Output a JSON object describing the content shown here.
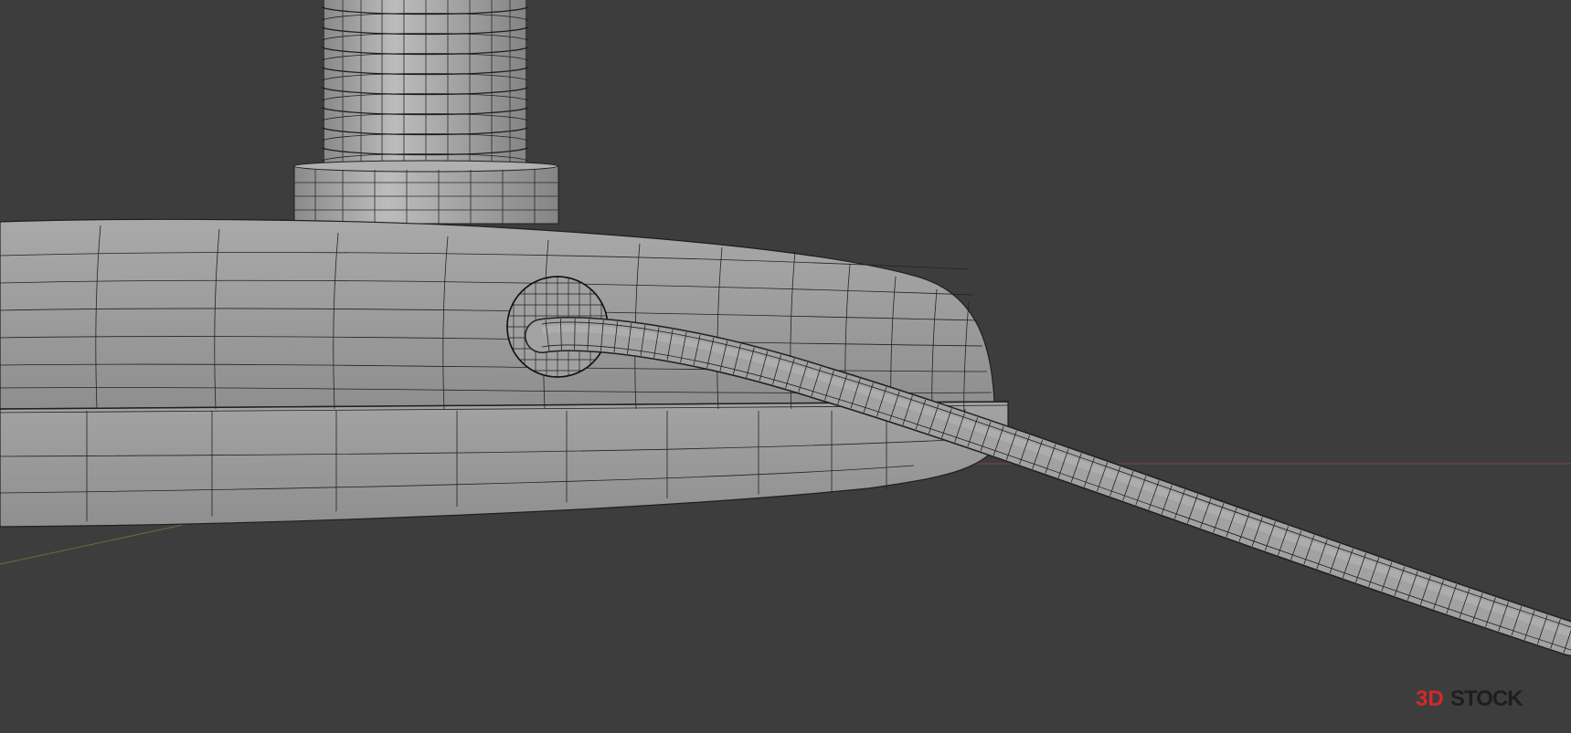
{
  "viewport": {
    "background_color": "#3d3d3d",
    "mesh_fill_color": "#9c9c9c",
    "wire_color": "#1f1f1f",
    "axis_x_color": "#8a4a4a",
    "axis_y_color": "#5f7a3c"
  },
  "scene": {
    "objects": [
      {
        "name": "threaded-stem",
        "type": "mesh"
      },
      {
        "name": "stem-collar",
        "type": "mesh"
      },
      {
        "name": "lamp-base",
        "type": "mesh"
      },
      {
        "name": "cable-grommet",
        "type": "mesh"
      },
      {
        "name": "power-cable",
        "type": "mesh"
      }
    ]
  },
  "watermark": {
    "text_part1": "3D",
    "text_part2": "STOCK",
    "accent_color": "#d22a2a",
    "text_color": "#1e1e1e"
  }
}
